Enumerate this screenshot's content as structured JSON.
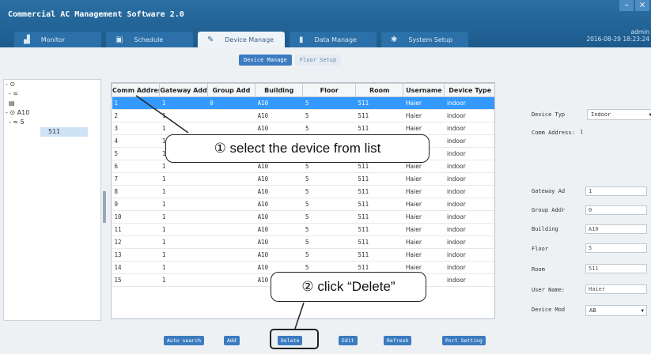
{
  "app": {
    "title": "Commercial AC Management Software 2.0",
    "minimize": "–",
    "close": "×"
  },
  "tabs": [
    {
      "label": "Monitor",
      "icon": "monitor-icon",
      "glyph": "▟"
    },
    {
      "label": "Schedule",
      "icon": "calendar-icon",
      "glyph": "▣"
    },
    {
      "label": "Device Manager",
      "icon": "wrench-icon",
      "glyph": "✎"
    },
    {
      "label": "Data Manage",
      "icon": "bar-chart-icon",
      "glyph": "▮"
    },
    {
      "label": "System Setup",
      "icon": "gear-icon",
      "glyph": "✱"
    }
  ],
  "user": {
    "name": "admin",
    "datetime": "2016-08-29 18:23:24"
  },
  "subtabs": [
    "Device Manage",
    "Floor Setup"
  ],
  "tree": [
    "- ⊙",
    "  - ≈",
    "      ▤",
    "- ⊙ A10",
    "  - ≈ 5",
    "511"
  ],
  "table": {
    "columns": [
      "Comm Address",
      "Gateway Add",
      "Group Add",
      "Building",
      "Floor",
      "Room",
      "Username",
      "Device Type"
    ],
    "rows": [
      [
        "1",
        "1",
        "0",
        "A10",
        "5",
        "511",
        "Haier",
        "indoor"
      ],
      [
        "2",
        "1",
        "",
        "A10",
        "5",
        "511",
        "Haier",
        "indoor"
      ],
      [
        "3",
        "1",
        "",
        "A10",
        "5",
        "511",
        "Haier",
        "indoor"
      ],
      [
        "4",
        "1",
        "",
        "A10",
        "5",
        "511",
        "Haier",
        "indoor"
      ],
      [
        "5",
        "1",
        "",
        "A10",
        "5",
        "511",
        "Haier",
        "indoor"
      ],
      [
        "6",
        "1",
        "",
        "A10",
        "5",
        "511",
        "Haier",
        "indoor"
      ],
      [
        "7",
        "1",
        "",
        "A10",
        "5",
        "511",
        "Haier",
        "indoor"
      ],
      [
        "8",
        "1",
        "",
        "A10",
        "5",
        "511",
        "Haier",
        "indoor"
      ],
      [
        "9",
        "1",
        "",
        "A10",
        "5",
        "511",
        "Haier",
        "indoor"
      ],
      [
        "10",
        "1",
        "",
        "A10",
        "5",
        "511",
        "Haier",
        "indoor"
      ],
      [
        "11",
        "1",
        "",
        "A10",
        "5",
        "511",
        "Haier",
        "indoor"
      ],
      [
        "12",
        "1",
        "",
        "A10",
        "5",
        "511",
        "Haier",
        "indoor"
      ],
      [
        "13",
        "1",
        "",
        "A10",
        "5",
        "511",
        "Haier",
        "indoor"
      ],
      [
        "14",
        "1",
        "",
        "A10",
        "5",
        "511",
        "Haier",
        "indoor"
      ],
      [
        "15",
        "1",
        "",
        "A10",
        "5",
        "511",
        "Haier",
        "indoor"
      ]
    ]
  },
  "form": {
    "device_type_label": "Device Typ",
    "device_type_value": "Indoor",
    "comm_address_label": "Comm Address:",
    "comm_address_value": "1",
    "gateway_label": "Gateway Ad",
    "gateway_value": "1",
    "group_label": "Group Addr",
    "group_value": "0",
    "building_label": "Building",
    "building_value": "A10",
    "floor_label": "Floor",
    "floor_value": "5",
    "room_label": "Room",
    "room_value": "511",
    "username_label": "User Name:",
    "username_value": "Haier",
    "device_model_label": "Device Mod",
    "device_model_value": "AB"
  },
  "buttons": {
    "auto_search": "Auto search",
    "add": "Add",
    "delete": "Delete",
    "edit": "Edit",
    "refresh": "Refresh",
    "port_setting": "Port Setting"
  },
  "annotations": {
    "step1": "① select the device from list",
    "step2": "② click “Delete”"
  },
  "colors": {
    "title_bar": "#1d5a8c",
    "selection": "#3399ff",
    "button": "#3b7bc0"
  }
}
